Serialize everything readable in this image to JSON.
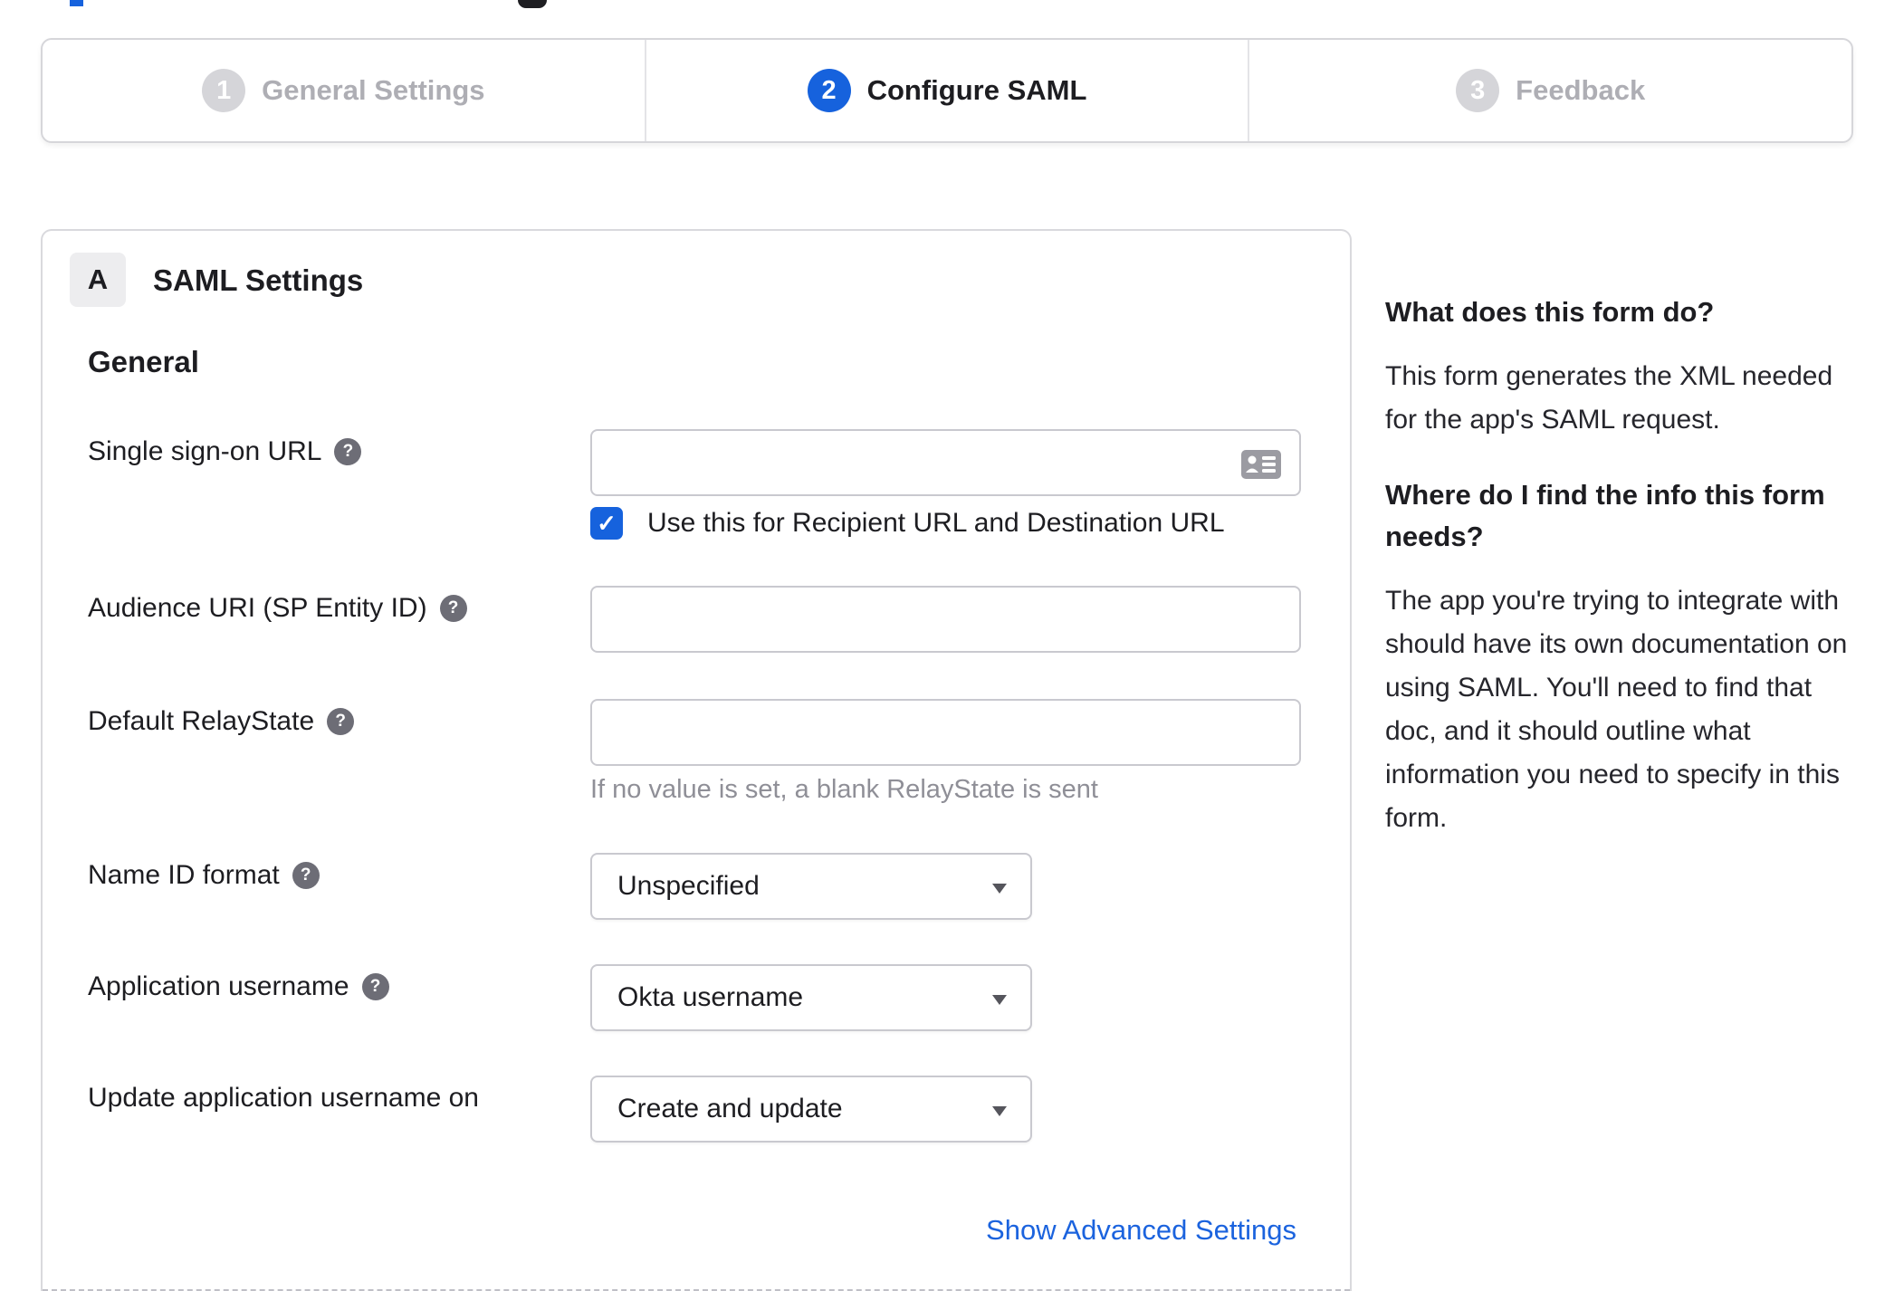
{
  "colors": {
    "accent_blue": "#1662dd",
    "link_blue": "#1b63de",
    "inactive_gray": "#d5d5d9",
    "border_gray": "#c9c9cf"
  },
  "icons": {
    "help_glyph": "?",
    "check_glyph": "✓"
  },
  "stepper": {
    "steps": [
      {
        "number": "1",
        "label": "General Settings",
        "state": "inactive"
      },
      {
        "number": "2",
        "label": "Configure SAML",
        "state": "active"
      },
      {
        "number": "3",
        "label": "Feedback",
        "state": "inactive"
      }
    ]
  },
  "panel": {
    "section_badge": "A",
    "section_title": "SAML Settings",
    "group_title": "General",
    "fields": {
      "sso": {
        "label": "Single sign-on URL",
        "value": "",
        "checkbox_label": "Use this for Recipient URL and Destination URL",
        "checked": true
      },
      "audience": {
        "label": "Audience URI (SP Entity ID)",
        "value": ""
      },
      "relay": {
        "label": "Default RelayState",
        "value": "",
        "hint": "If no value is set, a blank RelayState is sent"
      },
      "nameid": {
        "label": "Name ID format",
        "value": "Unspecified"
      },
      "appuser": {
        "label": "Application username",
        "value": "Okta username"
      },
      "updateuser": {
        "label": "Update application username on",
        "value": "Create and update"
      }
    },
    "advanced_link": "Show Advanced Settings"
  },
  "sidebar": {
    "heading1": "What does this form do?",
    "para1": "This form generates the XML needed for the app's SAML request.",
    "heading2": "Where do I find the info this form needs?",
    "para2": "The app you're trying to integrate with should have its own documentation on using SAML. You'll need to find that doc, and it should outline what information you need to specify in this form."
  }
}
